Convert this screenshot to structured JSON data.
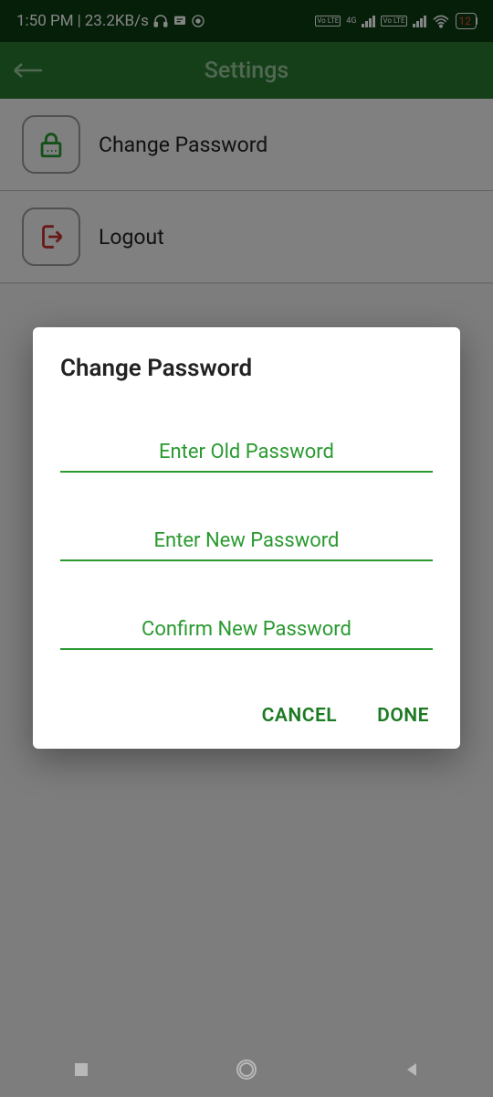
{
  "status": {
    "time": "1:50 PM",
    "speed": "23.2KB/s",
    "battery": "12",
    "sim_label": "Vo LTE",
    "net_label": "4G"
  },
  "appbar": {
    "title": "Settings"
  },
  "settings": {
    "change_password": "Change Password",
    "logout": "Logout"
  },
  "dialog": {
    "title": "Change Password",
    "old_placeholder": "Enter Old Password",
    "new_placeholder": "Enter New Password",
    "confirm_placeholder": "Confirm New Password",
    "cancel": "CANCEL",
    "done": "DONE"
  },
  "colors": {
    "primary": "#2a7a30",
    "accent": "#2a9a30"
  }
}
